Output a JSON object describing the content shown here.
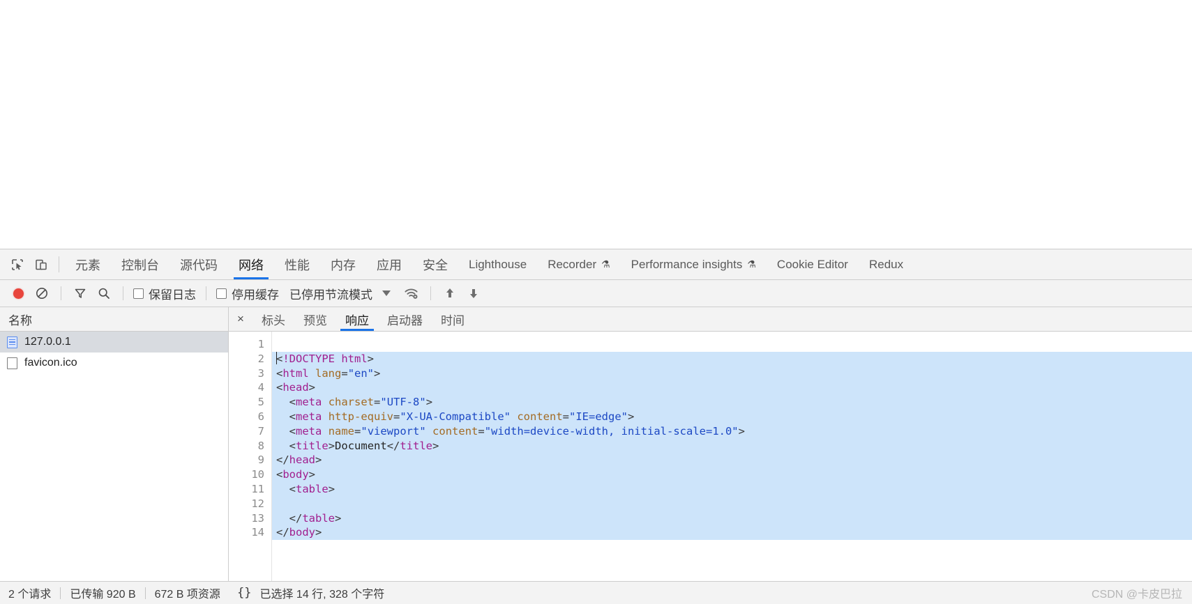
{
  "devtools": {
    "left_icons": [
      {
        "name": "inspect-element-icon",
        "glyph": "inspect"
      },
      {
        "name": "device-toolbar-icon",
        "glyph": "device"
      }
    ],
    "tabs": [
      {
        "label": "元素",
        "cjk": true,
        "active": false
      },
      {
        "label": "控制台",
        "cjk": true,
        "active": false
      },
      {
        "label": "源代码",
        "cjk": true,
        "active": false
      },
      {
        "label": "网络",
        "cjk": true,
        "active": true
      },
      {
        "label": "性能",
        "cjk": true,
        "active": false
      },
      {
        "label": "内存",
        "cjk": true,
        "active": false
      },
      {
        "label": "应用",
        "cjk": true,
        "active": false
      },
      {
        "label": "安全",
        "cjk": true,
        "active": false
      },
      {
        "label": "Lighthouse",
        "cjk": false,
        "active": false
      },
      {
        "label": "Recorder",
        "cjk": false,
        "active": false,
        "flask": "⚗"
      },
      {
        "label": "Performance insights",
        "cjk": false,
        "active": false,
        "flask": "⚗"
      },
      {
        "label": "Cookie Editor",
        "cjk": false,
        "active": false
      },
      {
        "label": "Redux",
        "cjk": false,
        "active": false
      }
    ]
  },
  "network_toolbar": {
    "record_button": "record-network-log",
    "clear_button": "clear-network-log",
    "filter_button": "filter",
    "search_button": "search",
    "preserve_log": {
      "label": "保留日志",
      "checked": false
    },
    "disable_cache": {
      "label": "停用缓存",
      "checked": false
    },
    "throttling": {
      "label": "已停用节流模式"
    },
    "network_conditions_icon": "network-conditions",
    "import_label": "import-har",
    "export_label": "export-har"
  },
  "request_list": {
    "column_header": "名称",
    "rows": [
      {
        "name": "127.0.0.1",
        "icon": "document-icon",
        "selected": true
      },
      {
        "name": "favicon.ico",
        "icon": "blank-document-icon",
        "selected": false
      }
    ]
  },
  "detail_panel": {
    "close_label": "×",
    "tabs": [
      {
        "label": "标头",
        "active": false
      },
      {
        "label": "预览",
        "active": false
      },
      {
        "label": "响应",
        "active": true
      },
      {
        "label": "启动器",
        "active": false
      },
      {
        "label": "时间",
        "active": false
      }
    ]
  },
  "code": {
    "line_numbers": [
      1,
      2,
      3,
      4,
      5,
      6,
      7,
      8,
      9,
      10,
      11,
      12,
      13,
      14
    ],
    "lines": [
      {
        "n": 1,
        "selected": false,
        "indent": 0,
        "tokens": []
      },
      {
        "n": 2,
        "selected": true,
        "indent": 0,
        "tokens": [
          {
            "t": "punct",
            "v": "<"
          },
          {
            "t": "tagname",
            "v": "!DOCTYPE html"
          },
          {
            "t": "punct",
            "v": ">"
          }
        ]
      },
      {
        "n": 3,
        "selected": true,
        "indent": 0,
        "tokens": [
          {
            "t": "punct",
            "v": "<"
          },
          {
            "t": "tagname",
            "v": "html"
          },
          {
            "t": "punct",
            "v": " "
          },
          {
            "t": "attr",
            "v": "lang"
          },
          {
            "t": "punct",
            "v": "="
          },
          {
            "t": "val",
            "v": "\"en\""
          },
          {
            "t": "punct",
            "v": ">"
          }
        ]
      },
      {
        "n": 4,
        "selected": true,
        "indent": 0,
        "tokens": [
          {
            "t": "punct",
            "v": "<"
          },
          {
            "t": "tagname",
            "v": "head"
          },
          {
            "t": "punct",
            "v": ">"
          }
        ]
      },
      {
        "n": 5,
        "selected": true,
        "indent": 1,
        "tokens": [
          {
            "t": "punct",
            "v": "<"
          },
          {
            "t": "tagname",
            "v": "meta"
          },
          {
            "t": "punct",
            "v": " "
          },
          {
            "t": "attr",
            "v": "charset"
          },
          {
            "t": "punct",
            "v": "="
          },
          {
            "t": "val",
            "v": "\"UTF-8\""
          },
          {
            "t": "punct",
            "v": ">"
          }
        ]
      },
      {
        "n": 6,
        "selected": true,
        "indent": 1,
        "tokens": [
          {
            "t": "punct",
            "v": "<"
          },
          {
            "t": "tagname",
            "v": "meta"
          },
          {
            "t": "punct",
            "v": " "
          },
          {
            "t": "attr",
            "v": "http-equiv"
          },
          {
            "t": "punct",
            "v": "="
          },
          {
            "t": "val",
            "v": "\"X-UA-Compatible\""
          },
          {
            "t": "punct",
            "v": " "
          },
          {
            "t": "attr",
            "v": "content"
          },
          {
            "t": "punct",
            "v": "="
          },
          {
            "t": "val",
            "v": "\"IE=edge\""
          },
          {
            "t": "punct",
            "v": ">"
          }
        ]
      },
      {
        "n": 7,
        "selected": true,
        "indent": 1,
        "tokens": [
          {
            "t": "punct",
            "v": "<"
          },
          {
            "t": "tagname",
            "v": "meta"
          },
          {
            "t": "punct",
            "v": " "
          },
          {
            "t": "attr",
            "v": "name"
          },
          {
            "t": "punct",
            "v": "="
          },
          {
            "t": "val",
            "v": "\"viewport\""
          },
          {
            "t": "punct",
            "v": " "
          },
          {
            "t": "attr",
            "v": "content"
          },
          {
            "t": "punct",
            "v": "="
          },
          {
            "t": "val",
            "v": "\"width=device-width, initial-scale=1.0\""
          },
          {
            "t": "punct",
            "v": ">"
          }
        ]
      },
      {
        "n": 8,
        "selected": true,
        "indent": 1,
        "tokens": [
          {
            "t": "punct",
            "v": "<"
          },
          {
            "t": "tagname",
            "v": "title"
          },
          {
            "t": "punct",
            "v": ">"
          },
          {
            "t": "txt",
            "v": "Document"
          },
          {
            "t": "punct",
            "v": "</"
          },
          {
            "t": "tagname",
            "v": "title"
          },
          {
            "t": "punct",
            "v": ">"
          }
        ]
      },
      {
        "n": 9,
        "selected": true,
        "indent": 0,
        "tokens": [
          {
            "t": "punct",
            "v": "</"
          },
          {
            "t": "tagname",
            "v": "head"
          },
          {
            "t": "punct",
            "v": ">"
          }
        ]
      },
      {
        "n": 10,
        "selected": true,
        "indent": 0,
        "tokens": [
          {
            "t": "punct",
            "v": "<"
          },
          {
            "t": "tagname",
            "v": "body"
          },
          {
            "t": "punct",
            "v": ">"
          }
        ]
      },
      {
        "n": 11,
        "selected": true,
        "indent": 1,
        "tokens": [
          {
            "t": "punct",
            "v": "<"
          },
          {
            "t": "tagname",
            "v": "table"
          },
          {
            "t": "punct",
            "v": ">"
          }
        ]
      },
      {
        "n": 12,
        "selected": true,
        "indent": 0,
        "tokens": []
      },
      {
        "n": 13,
        "selected": true,
        "indent": 1,
        "tokens": [
          {
            "t": "punct",
            "v": "</"
          },
          {
            "t": "tagname",
            "v": "table"
          },
          {
            "t": "punct",
            "v": ">"
          }
        ]
      },
      {
        "n": 14,
        "selected": true,
        "indent": 0,
        "tokens": [
          {
            "t": "punct",
            "v": "</"
          },
          {
            "t": "tagname",
            "v": "body"
          },
          {
            "t": "punct",
            "v": ">"
          }
        ]
      }
    ]
  },
  "status_bar": {
    "requests": "2 个请求",
    "transferred": "已传输 920 B",
    "resources": "672 B 项资源",
    "brace_icon": "{}",
    "selection": "已选择 14 行, 328 个字符",
    "watermark": "CSDN @卡皮巴拉"
  },
  "colors": {
    "accent": "#1a73e8",
    "record": "#e8453c",
    "selection": "#cde4fa",
    "chrome_bg": "#f3f3f3"
  }
}
